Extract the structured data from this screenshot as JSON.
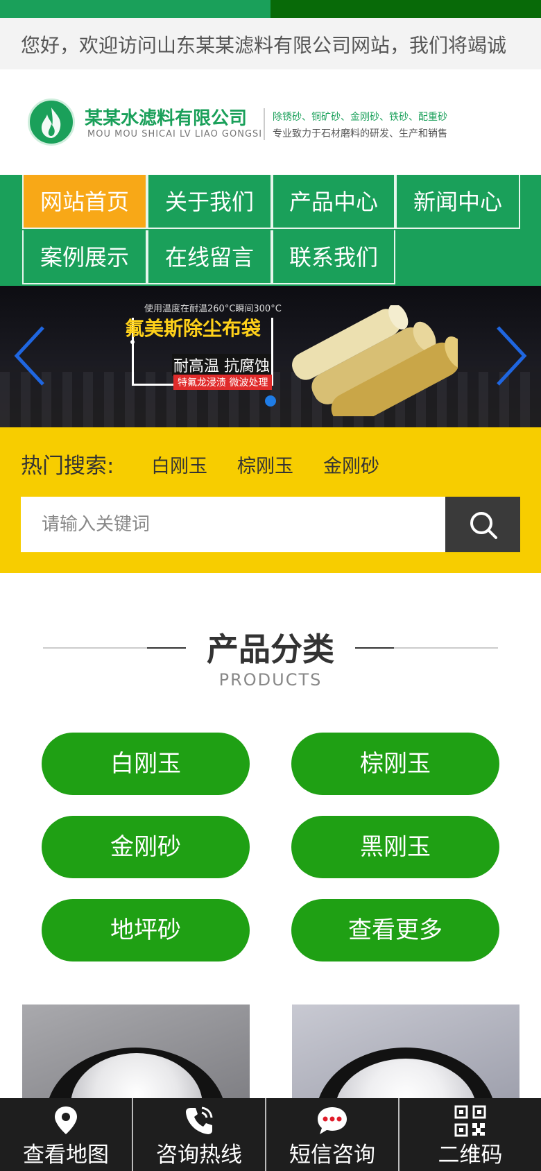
{
  "topbar": {
    "left_color": "#1aa05a",
    "right_color": "#086a08"
  },
  "welcome": {
    "text": "您好，欢迎访问山东某某滤料有限公司网站，我们将竭诚"
  },
  "header": {
    "brand_cn": "某某水滤料有限公司",
    "brand_en": "MOU MOU SHICAI LV LIAO GONGSI",
    "slogan_line1": "除锈砂、铜矿砂、金刚砂、铁砂、配重砂",
    "slogan_line2": "专业致力于石材磨料的研发、生产和销售",
    "logo_icon": "flame-logo-icon"
  },
  "nav": {
    "items": [
      {
        "label": "网站首页",
        "active": true
      },
      {
        "label": "关于我们"
      },
      {
        "label": "产品中心"
      },
      {
        "label": "新闻中心"
      },
      {
        "label": "案例展示"
      },
      {
        "label": "在线留言"
      },
      {
        "label": "联系我们"
      }
    ],
    "active_color": "#f8a817",
    "bg_color": "#1aa05a"
  },
  "banner": {
    "small_text": "使用温度在耐温260°C瞬间300°C",
    "title": "氟美斯除尘布袋",
    "subtitle": "耐高温 抗腐蚀",
    "tag": "特氟龙浸渍  微波处理",
    "slide_index": 1,
    "slide_count": 1
  },
  "hot_search": {
    "label": "热门搜索:",
    "links": [
      "白刚玉",
      "棕刚玉",
      "金刚砂"
    ],
    "placeholder": "请输入关键词",
    "bg_color": "#f7cd00"
  },
  "products_section": {
    "title": "产品分类",
    "subtitle": "PRODUCTS",
    "categories": [
      "白刚玉",
      "棕刚玉",
      "金刚砂",
      "黑刚玉",
      "地坪砂",
      "查看更多"
    ],
    "button_color": "#1fa014"
  },
  "footer": {
    "items": [
      {
        "label": "查看地图",
        "icon": "map-pin-icon"
      },
      {
        "label": "咨询热线",
        "icon": "phone-icon"
      },
      {
        "label": "短信咨询",
        "icon": "chat-bubble-icon"
      },
      {
        "label": "二维码",
        "icon": "qr-code-icon"
      }
    ]
  }
}
